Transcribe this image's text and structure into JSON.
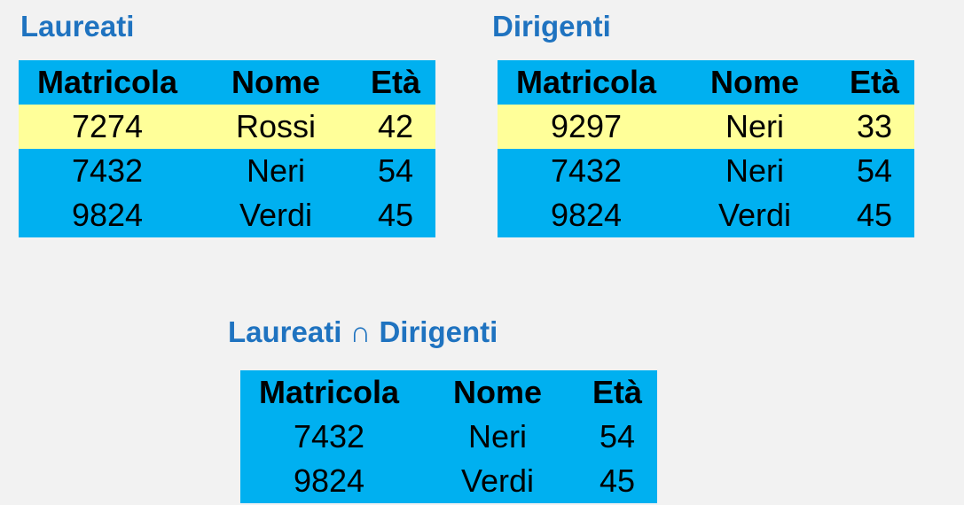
{
  "laureati": {
    "title": "Laureati",
    "headers": [
      "Matricola",
      "Nome",
      "Età"
    ],
    "rows": [
      {
        "matricola": "7274",
        "nome": "Rossi",
        "eta": "42",
        "highlighted": true
      },
      {
        "matricola": "7432",
        "nome": "Neri",
        "eta": "54",
        "highlighted": false
      },
      {
        "matricola": "9824",
        "nome": "Verdi",
        "eta": "45",
        "highlighted": false
      }
    ]
  },
  "dirigenti": {
    "title": "Dirigenti",
    "headers": [
      "Matricola",
      "Nome",
      "Età"
    ],
    "rows": [
      {
        "matricola": "9297",
        "nome": "Neri",
        "eta": "33",
        "highlighted": true
      },
      {
        "matricola": "7432",
        "nome": "Neri",
        "eta": "54",
        "highlighted": false
      },
      {
        "matricola": "9824",
        "nome": "Verdi",
        "eta": "45",
        "highlighted": false
      }
    ]
  },
  "intersezione": {
    "title_left": "Laureati",
    "operator": "∩",
    "title_right": "Dirigenti",
    "headers": [
      "Matricola",
      "Nome",
      "Età"
    ],
    "rows": [
      {
        "matricola": "7432",
        "nome": "Neri",
        "eta": "54",
        "highlighted": false
      },
      {
        "matricola": "9824",
        "nome": "Verdi",
        "eta": "45",
        "highlighted": false
      }
    ]
  },
  "colors": {
    "page_background": "#f2f2f2",
    "title_text": "#1f73c0",
    "table_background": "#00b0f0",
    "highlight_row": "#ffff99"
  }
}
